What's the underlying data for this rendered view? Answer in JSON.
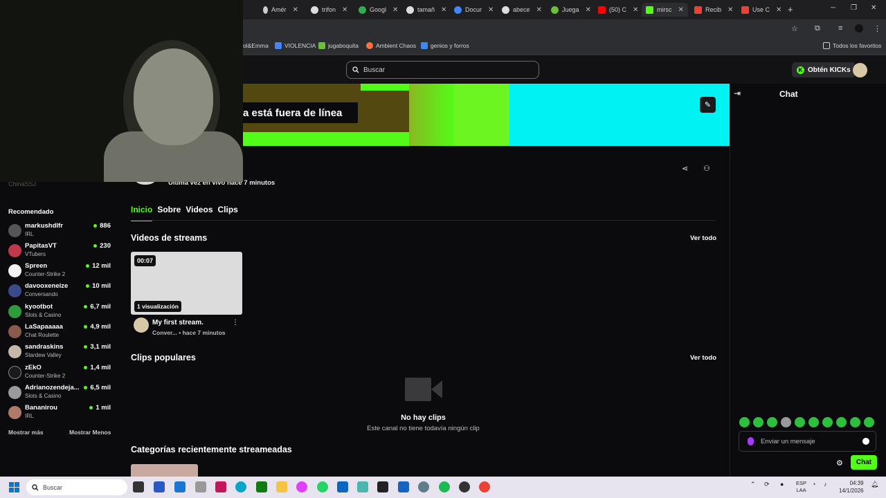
{
  "browser": {
    "tabs": [
      {
        "label": "Amér",
        "color": "#ffffff"
      },
      {
        "label": "trifon",
        "color": "#ffffff"
      },
      {
        "label": "Googl",
        "color": "#34a853"
      },
      {
        "label": "tamañ",
        "color": "#ffffff"
      },
      {
        "label": "Docur",
        "color": "#4285f4"
      },
      {
        "label": "abece",
        "color": "#ffffff"
      },
      {
        "label": "Juega",
        "color": "#6bbf3a"
      },
      {
        "label": "(50) C",
        "color": "#ff0000"
      },
      {
        "label": "mirsc",
        "color": "#53fc18"
      },
      {
        "label": "Recib",
        "color": "#ea4335"
      },
      {
        "label": "Use C",
        "color": "#ea4335"
      }
    ],
    "bookmarks": [
      {
        "label": "ol&Emma",
        "color": "#ffffff"
      },
      {
        "label": "VIOLENCIA",
        "color": "#4285f4"
      },
      {
        "label": "jugaboquita",
        "color": "#6bbf3a"
      },
      {
        "label": "Ambient Chaos",
        "color": "#ff7043"
      },
      {
        "label": "genios y forros",
        "color": "#4285f4"
      },
      {
        "label": "Todos los favoritos",
        "color": "#cfcfcf"
      }
    ]
  },
  "kick": {
    "search_placeholder": "Buscar",
    "get_kicks": "Obtén KICKs",
    "offline_text": "a está fuera de línea",
    "last_live": "Última vez en vivo hace 7 minutos",
    "sidebar_ghost": "ChinaSSJ",
    "tabs": [
      "Inicio",
      "Sobre",
      "Videos",
      "Clips"
    ],
    "streams_section": "Videos de streams",
    "see_all": "Ver todo",
    "video": {
      "duration": "00:07",
      "views": "1 visualización",
      "title": "My first stream.",
      "category": "Conver...",
      "ago": "• hace 7 minutos"
    },
    "clips_section": "Clips populares",
    "no_clips_title": "No hay clips",
    "no_clips_sub": "Este canal no tiene todavía ningún clip",
    "categories_section": "Categorías recientemente streameadas",
    "recommended_title": "Recomendado",
    "recommended": [
      {
        "name": "markushdlfr",
        "category": "IRL",
        "viewers": "886",
        "color": "#555555"
      },
      {
        "name": "PapitasVT",
        "category": "VTubers",
        "viewers": "230",
        "color": "#c0394b"
      },
      {
        "name": "Spreen",
        "category": "Counter-Strike 2",
        "viewers": "12 mil",
        "color": "#f2f2f2"
      },
      {
        "name": "davooxeneize",
        "category": "Conversando",
        "viewers": "10 mil",
        "color": "#3a4a8a"
      },
      {
        "name": "kyootbot",
        "category": "Slots & Casino",
        "viewers": "6,7 mil",
        "color": "#2e9c3a"
      },
      {
        "name": "LaSapaaaaa",
        "category": "Chat Roulette",
        "viewers": "4,9 mil",
        "color": "#8a5a4a"
      },
      {
        "name": "sandraskins",
        "category": "Stardew Valley",
        "viewers": "3,1 mil",
        "color": "#c8b8a8"
      },
      {
        "name": "zEkO",
        "category": "Counter-Strike 2",
        "viewers": "1,4 mil",
        "color": "#1a1a1a"
      },
      {
        "name": "Adrianozendeja...",
        "category": "Slots & Casino",
        "viewers": "6,5 mil",
        "color": "#9a9a9a"
      },
      {
        "name": "Bananirou",
        "category": "IRL",
        "viewers": "1 mil",
        "color": "#b07a6a"
      }
    ],
    "show_more": "Mostrar más",
    "show_less": "Mostrar Menos",
    "chat_title": "Chat",
    "chat_placeholder": "Enviar un mensaje",
    "chat_button": "Chat"
  },
  "taskbar": {
    "search": "Buscar",
    "lang": "ESP",
    "region": "LAA",
    "time": "04:39",
    "date": "14/1/2026"
  },
  "colors": {
    "accent": "#53fc18",
    "background": "#0b0b0d",
    "banner_cyan": "#00f2f2"
  }
}
